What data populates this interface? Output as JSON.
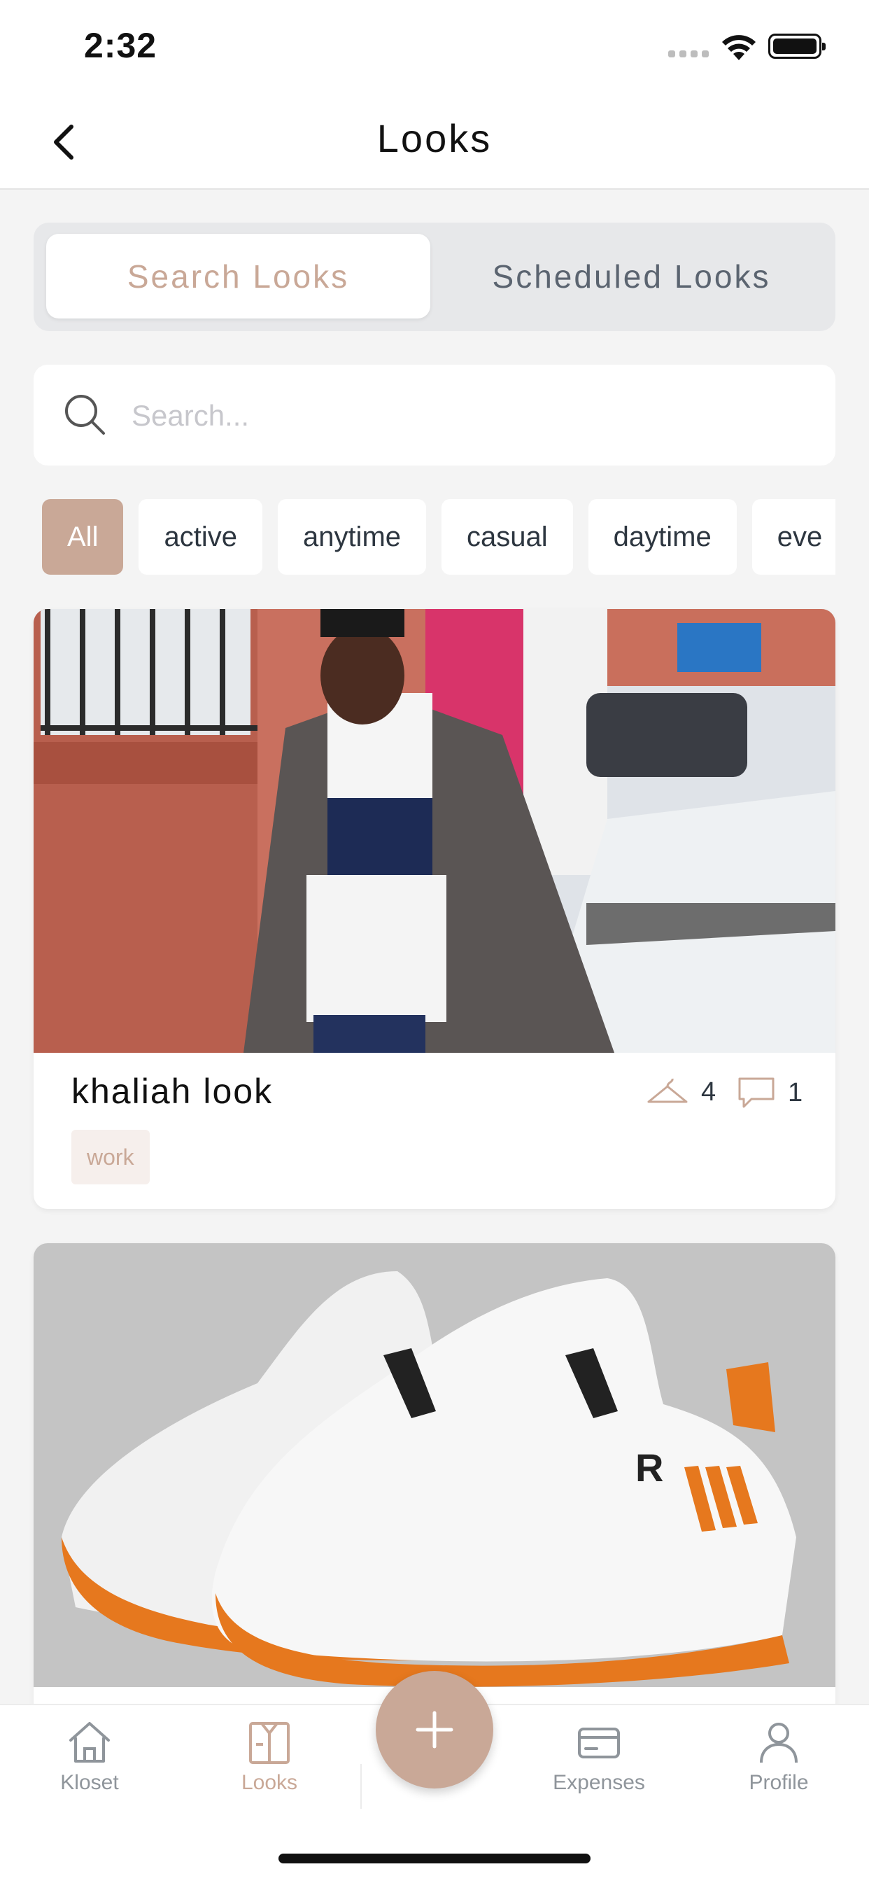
{
  "status": {
    "time": "2:32"
  },
  "nav": {
    "title": "Looks"
  },
  "segments": {
    "search": "Search Looks",
    "scheduled": "Scheduled Looks"
  },
  "search": {
    "placeholder": "Search..."
  },
  "chips": [
    "All",
    "active",
    "anytime",
    "casual",
    "daytime",
    "eve"
  ],
  "looks": [
    {
      "title": "khaliah look",
      "items": "4",
      "comments": "1",
      "tag": "work"
    }
  ],
  "tabs": {
    "kloset": "Kloset",
    "looks": "Looks",
    "expenses": "Expenses",
    "profile": "Profile"
  },
  "colors": {
    "accent": "#c9a897",
    "text": "#111111",
    "muted": "#8f959b",
    "background": "#f4f4f4"
  }
}
